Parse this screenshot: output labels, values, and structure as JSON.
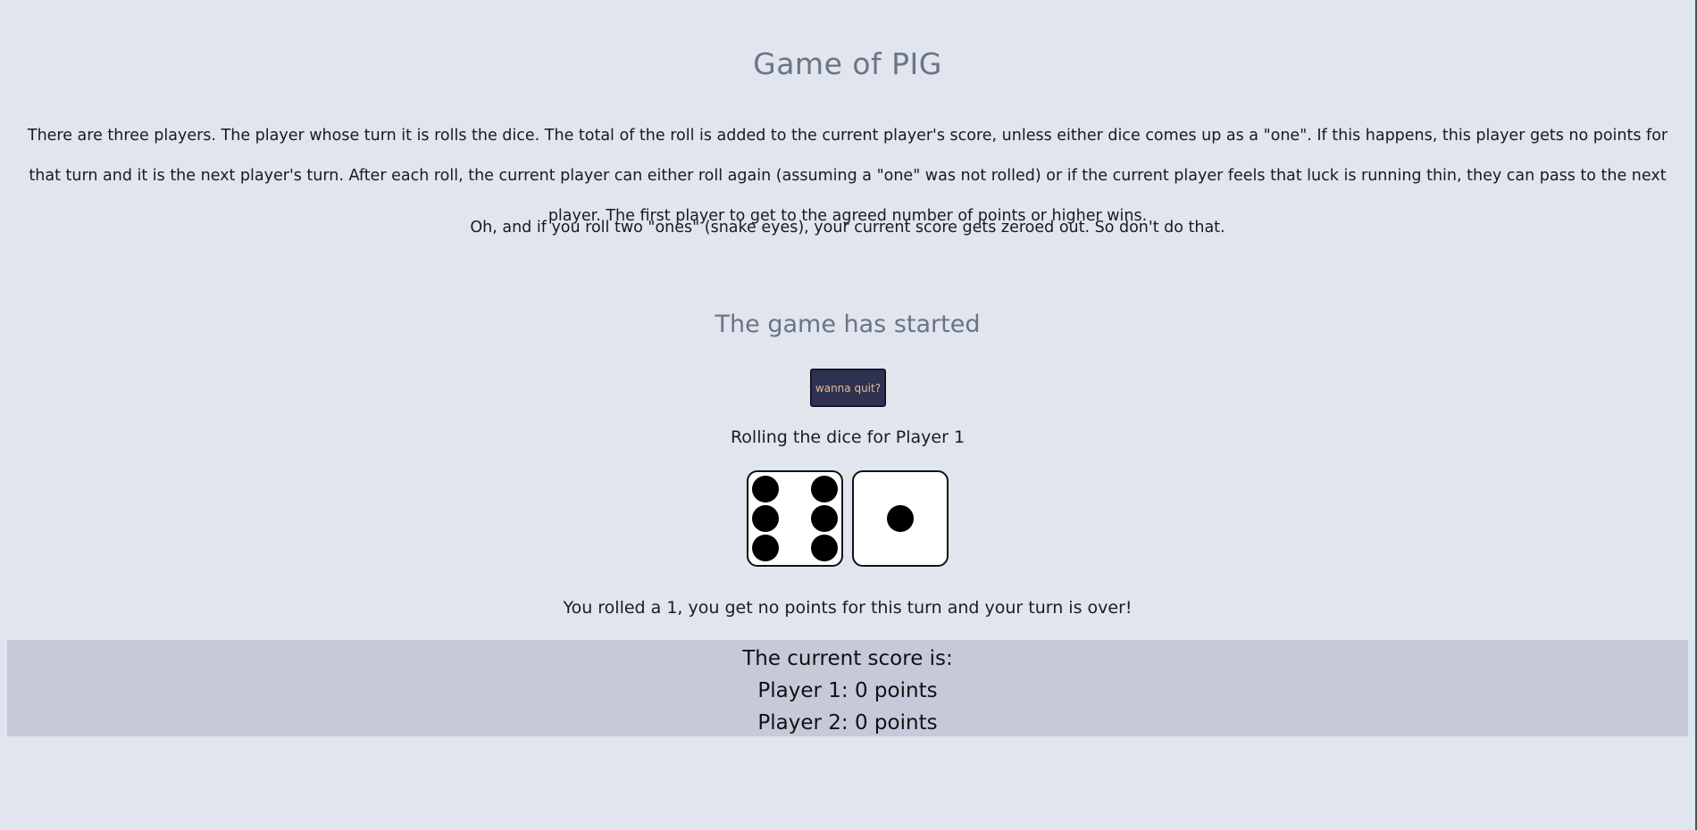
{
  "title": "Game of PIG",
  "rules_text": "There are three players. The player whose turn it is rolls the dice. The total of the roll is added to the current player's score, unless either dice comes up as a \"one\". If this happens, this player gets no points for that turn and it is the next player's turn. After each roll, the current player can either roll again (assuming a \"one\" was not rolled) or if the current player feels that luck is running thin, they can pass to the next player. The first player to get to the agreed number of points or higher wins.",
  "snake_eyes_text": "Oh, and if you roll two \"ones\" (snake eyes), your current score gets zeroed out. So don't do that.",
  "status_heading": "The game has started",
  "quit_button_label": "wanna quit?",
  "rolling_text": "Rolling the dice for Player 1",
  "dice": [
    {
      "value": 6
    },
    {
      "value": 1
    }
  ],
  "result_text": "You rolled a 1, you get no points for this turn and your turn is over!",
  "score": {
    "heading": "The current score is:",
    "players": [
      "Player 1: 0 points",
      "Player 2: 0 points"
    ]
  }
}
